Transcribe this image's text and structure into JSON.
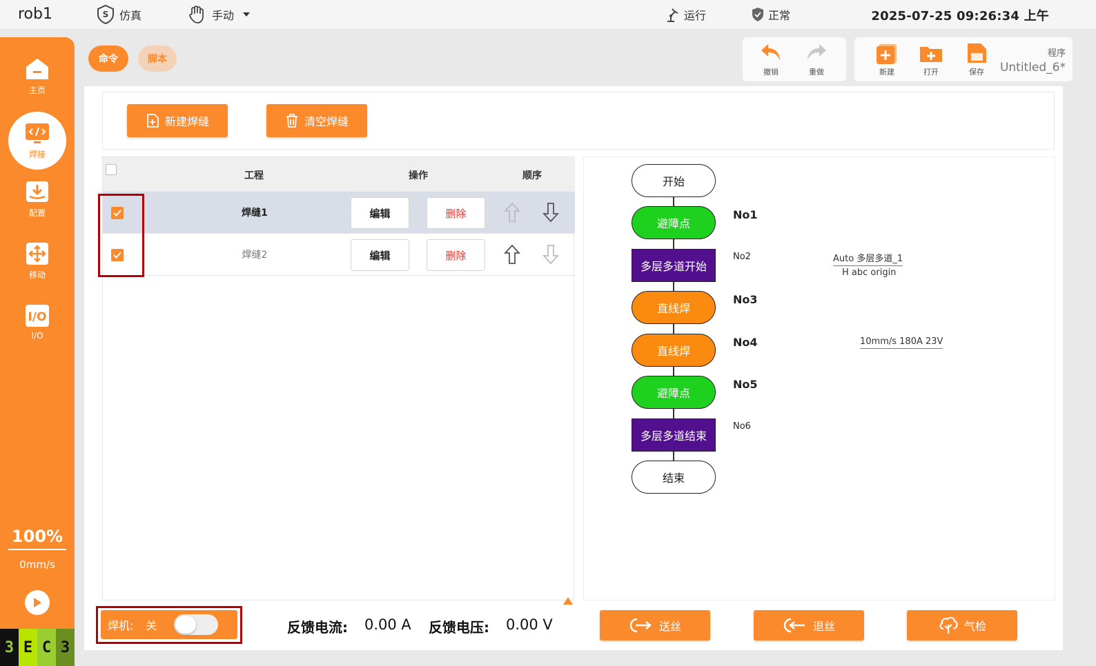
{
  "topbar": {
    "robot": "rob1",
    "sim_label": "仿真",
    "mode_label": "手动",
    "run_label": "运行",
    "status_label": "正常",
    "datetime": "2025-07-25 09:26:34 上午"
  },
  "sidebar": {
    "items": [
      {
        "label": "主页",
        "icon": "home-icon"
      },
      {
        "label": "焊接",
        "icon": "code-monitor-icon"
      },
      {
        "label": "配置",
        "icon": "download-tray-icon"
      },
      {
        "label": "移动",
        "icon": "move-cross-icon"
      },
      {
        "label": "I/O",
        "icon": "io-icon"
      }
    ],
    "speed_pct": "100%",
    "speed_mms": "0mm/s",
    "logo": [
      "3",
      "E",
      "C",
      "3"
    ]
  },
  "tabs": {
    "command": "命令",
    "script": "脚本"
  },
  "toolbar": {
    "undo": "撤销",
    "redo": "重做",
    "new": "新建",
    "open": "打开",
    "save": "保存",
    "program_caption": "程序",
    "program_name": "Untitled_6*"
  },
  "actions": {
    "new_seam": "新建焊缝",
    "clear_seam": "清空焊缝"
  },
  "table": {
    "headers": {
      "project": "工程",
      "ops": "操作",
      "order": "顺序"
    },
    "rows": [
      {
        "name": "焊缝1",
        "edit": "编辑",
        "delete": "删除",
        "checked": true
      },
      {
        "name": "焊缝2",
        "edit": "编辑",
        "delete": "删除",
        "checked": true
      }
    ]
  },
  "flow": {
    "start": "开始",
    "end": "结束",
    "nodes": [
      {
        "text": "避障点",
        "no": "No1"
      },
      {
        "text": "多层多道开始",
        "no": "No2",
        "param1": "Auto 多层多道_1",
        "param2": "H abc origin"
      },
      {
        "text": "直线焊",
        "no": "No3"
      },
      {
        "text": "直线焊",
        "no": "No4",
        "param1": "10mm/s 180A 23V"
      },
      {
        "text": "避障点",
        "no": "No5"
      },
      {
        "text": "多层多道结束",
        "no": "No6"
      }
    ]
  },
  "bottom": {
    "welder_label": "焊机:",
    "welder_state": "关",
    "current_label": "反馈电流:",
    "current_value": "0.00 A",
    "voltage_label": "反馈电压:",
    "voltage_value": "0.00 V",
    "feed_wire": "送丝",
    "retract_wire": "退丝",
    "gas_check": "气检"
  },
  "colors": {
    "accent": "#fb8a2c",
    "green_node": "#1fd11f",
    "orange_node": "#fb8a10",
    "purple_node": "#53108e",
    "delete_red": "#e53935"
  }
}
